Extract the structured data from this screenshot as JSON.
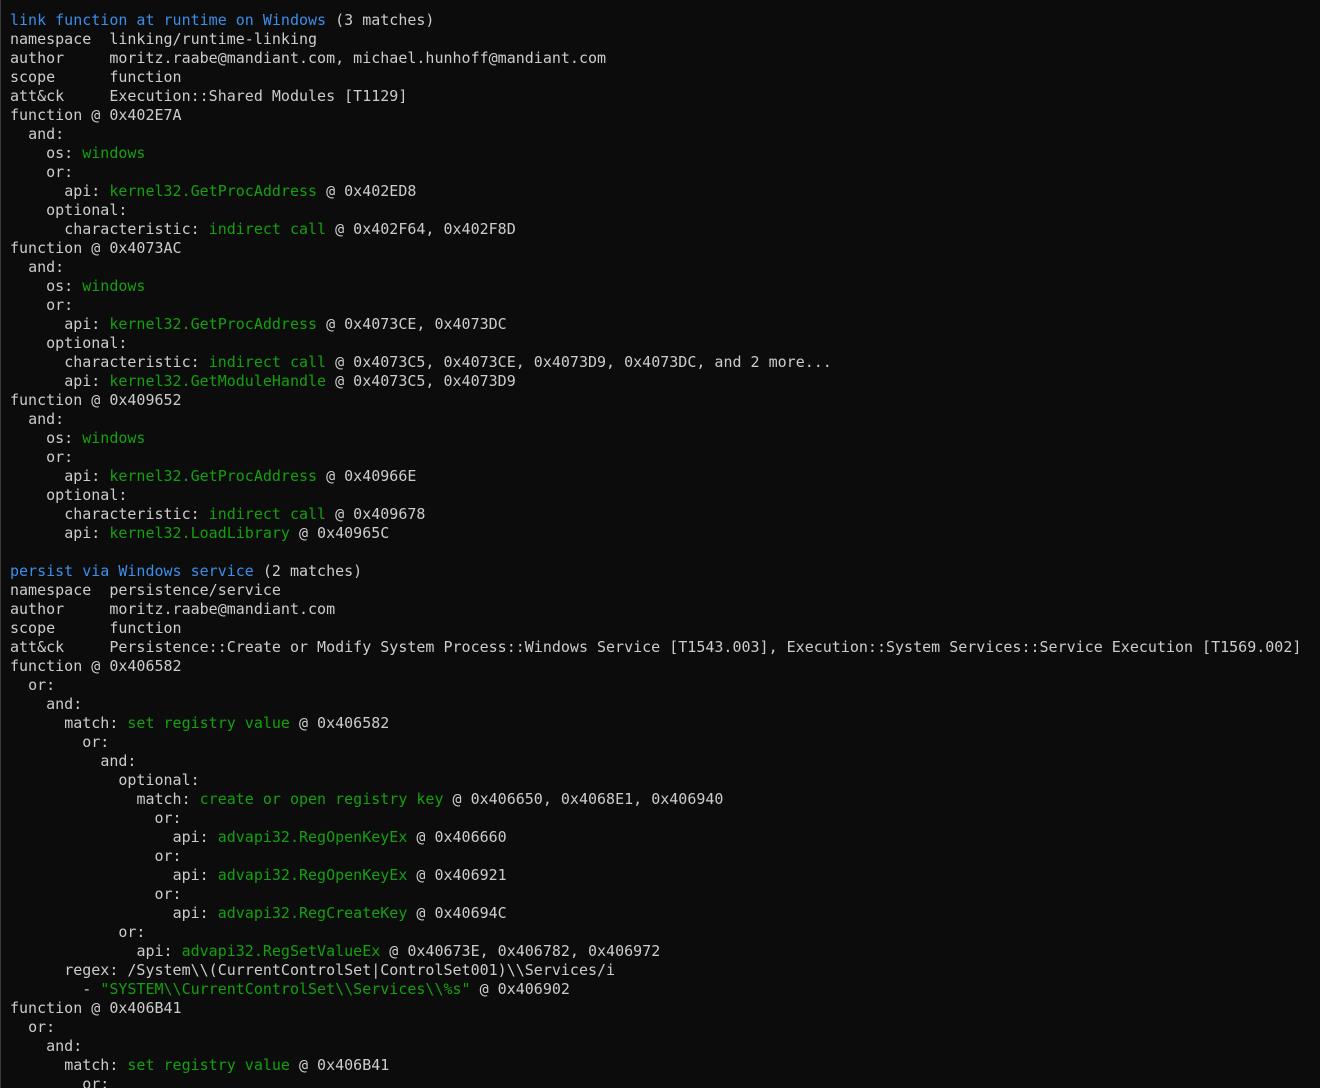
{
  "colors": {
    "background": "#0c0c0c",
    "text": "#cccccc",
    "rule_name": "#3b8eea",
    "feature_value": "#13a10e"
  },
  "lines": [
    {
      "indent": 0,
      "segments": [
        {
          "t": "link function at runtime on Windows",
          "c": "blue"
        },
        {
          "t": " (3 matches)",
          "c": "plain"
        }
      ]
    },
    {
      "indent": 0,
      "segments": [
        {
          "t": "namespace  linking/runtime-linking",
          "c": "plain"
        }
      ]
    },
    {
      "indent": 0,
      "segments": [
        {
          "t": "author     moritz.raabe@mandiant.com, michael.hunhoff@mandiant.com",
          "c": "plain"
        }
      ]
    },
    {
      "indent": 0,
      "segments": [
        {
          "t": "scope      function",
          "c": "plain"
        }
      ]
    },
    {
      "indent": 0,
      "segments": [
        {
          "t": "att&ck     Execution::Shared Modules [T1129]",
          "c": "plain"
        }
      ]
    },
    {
      "indent": 0,
      "segments": [
        {
          "t": "function @ 0x402E7A",
          "c": "plain"
        }
      ]
    },
    {
      "indent": 2,
      "segments": [
        {
          "t": "and:",
          "c": "plain"
        }
      ]
    },
    {
      "indent": 4,
      "segments": [
        {
          "t": "os: ",
          "c": "plain"
        },
        {
          "t": "windows",
          "c": "green"
        }
      ]
    },
    {
      "indent": 4,
      "segments": [
        {
          "t": "or:",
          "c": "plain"
        }
      ]
    },
    {
      "indent": 6,
      "segments": [
        {
          "t": "api: ",
          "c": "plain"
        },
        {
          "t": "kernel32.GetProcAddress",
          "c": "green"
        },
        {
          "t": " @ 0x402ED8",
          "c": "plain"
        }
      ]
    },
    {
      "indent": 4,
      "segments": [
        {
          "t": "optional:",
          "c": "plain"
        }
      ]
    },
    {
      "indent": 6,
      "segments": [
        {
          "t": "characteristic: ",
          "c": "plain"
        },
        {
          "t": "indirect call",
          "c": "green"
        },
        {
          "t": " @ 0x402F64, 0x402F8D",
          "c": "plain"
        }
      ]
    },
    {
      "indent": 0,
      "segments": [
        {
          "t": "function @ 0x4073AC",
          "c": "plain"
        }
      ]
    },
    {
      "indent": 2,
      "segments": [
        {
          "t": "and:",
          "c": "plain"
        }
      ]
    },
    {
      "indent": 4,
      "segments": [
        {
          "t": "os: ",
          "c": "plain"
        },
        {
          "t": "windows",
          "c": "green"
        }
      ]
    },
    {
      "indent": 4,
      "segments": [
        {
          "t": "or:",
          "c": "plain"
        }
      ]
    },
    {
      "indent": 6,
      "segments": [
        {
          "t": "api: ",
          "c": "plain"
        },
        {
          "t": "kernel32.GetProcAddress",
          "c": "green"
        },
        {
          "t": " @ 0x4073CE, 0x4073DC",
          "c": "plain"
        }
      ]
    },
    {
      "indent": 4,
      "segments": [
        {
          "t": "optional:",
          "c": "plain"
        }
      ]
    },
    {
      "indent": 6,
      "segments": [
        {
          "t": "characteristic: ",
          "c": "plain"
        },
        {
          "t": "indirect call",
          "c": "green"
        },
        {
          "t": " @ 0x4073C5, 0x4073CE, 0x4073D9, 0x4073DC, and 2 more...",
          "c": "plain"
        }
      ]
    },
    {
      "indent": 6,
      "segments": [
        {
          "t": "api: ",
          "c": "plain"
        },
        {
          "t": "kernel32.GetModuleHandle",
          "c": "green"
        },
        {
          "t": " @ 0x4073C5, 0x4073D9",
          "c": "plain"
        }
      ]
    },
    {
      "indent": 0,
      "segments": [
        {
          "t": "function @ 0x409652",
          "c": "plain"
        }
      ]
    },
    {
      "indent": 2,
      "segments": [
        {
          "t": "and:",
          "c": "plain"
        }
      ]
    },
    {
      "indent": 4,
      "segments": [
        {
          "t": "os: ",
          "c": "plain"
        },
        {
          "t": "windows",
          "c": "green"
        }
      ]
    },
    {
      "indent": 4,
      "segments": [
        {
          "t": "or:",
          "c": "plain"
        }
      ]
    },
    {
      "indent": 6,
      "segments": [
        {
          "t": "api: ",
          "c": "plain"
        },
        {
          "t": "kernel32.GetProcAddress",
          "c": "green"
        },
        {
          "t": " @ 0x40966E",
          "c": "plain"
        }
      ]
    },
    {
      "indent": 4,
      "segments": [
        {
          "t": "optional:",
          "c": "plain"
        }
      ]
    },
    {
      "indent": 6,
      "segments": [
        {
          "t": "characteristic: ",
          "c": "plain"
        },
        {
          "t": "indirect call",
          "c": "green"
        },
        {
          "t": " @ 0x409678",
          "c": "plain"
        }
      ]
    },
    {
      "indent": 6,
      "segments": [
        {
          "t": "api: ",
          "c": "plain"
        },
        {
          "t": "kernel32.LoadLibrary",
          "c": "green"
        },
        {
          "t": " @ 0x40965C",
          "c": "plain"
        }
      ]
    },
    {
      "indent": 0,
      "segments": []
    },
    {
      "indent": 0,
      "segments": [
        {
          "t": "persist via Windows service",
          "c": "blue"
        },
        {
          "t": " (2 matches)",
          "c": "plain"
        }
      ]
    },
    {
      "indent": 0,
      "segments": [
        {
          "t": "namespace  persistence/service",
          "c": "plain"
        }
      ]
    },
    {
      "indent": 0,
      "segments": [
        {
          "t": "author     moritz.raabe@mandiant.com",
          "c": "plain"
        }
      ]
    },
    {
      "indent": 0,
      "segments": [
        {
          "t": "scope      function",
          "c": "plain"
        }
      ]
    },
    {
      "indent": 0,
      "segments": [
        {
          "t": "att&ck     Persistence::Create or Modify System Process::Windows Service [T1543.003], Execution::System Services::Service Execution [T1569.002]",
          "c": "plain"
        }
      ]
    },
    {
      "indent": 0,
      "segments": [
        {
          "t": "function @ 0x406582",
          "c": "plain"
        }
      ]
    },
    {
      "indent": 2,
      "segments": [
        {
          "t": "or:",
          "c": "plain"
        }
      ]
    },
    {
      "indent": 4,
      "segments": [
        {
          "t": "and:",
          "c": "plain"
        }
      ]
    },
    {
      "indent": 6,
      "segments": [
        {
          "t": "match: ",
          "c": "plain"
        },
        {
          "t": "set registry value",
          "c": "green"
        },
        {
          "t": " @ 0x406582",
          "c": "plain"
        }
      ]
    },
    {
      "indent": 8,
      "segments": [
        {
          "t": "or:",
          "c": "plain"
        }
      ]
    },
    {
      "indent": 10,
      "segments": [
        {
          "t": "and:",
          "c": "plain"
        }
      ]
    },
    {
      "indent": 12,
      "segments": [
        {
          "t": "optional:",
          "c": "plain"
        }
      ]
    },
    {
      "indent": 14,
      "segments": [
        {
          "t": "match: ",
          "c": "plain"
        },
        {
          "t": "create or open registry key",
          "c": "green"
        },
        {
          "t": " @ 0x406650, 0x4068E1, 0x406940",
          "c": "plain"
        }
      ]
    },
    {
      "indent": 16,
      "segments": [
        {
          "t": "or:",
          "c": "plain"
        }
      ]
    },
    {
      "indent": 18,
      "segments": [
        {
          "t": "api: ",
          "c": "plain"
        },
        {
          "t": "advapi32.RegOpenKeyEx",
          "c": "green"
        },
        {
          "t": " @ 0x406660",
          "c": "plain"
        }
      ]
    },
    {
      "indent": 16,
      "segments": [
        {
          "t": "or:",
          "c": "plain"
        }
      ]
    },
    {
      "indent": 18,
      "segments": [
        {
          "t": "api: ",
          "c": "plain"
        },
        {
          "t": "advapi32.RegOpenKeyEx",
          "c": "green"
        },
        {
          "t": " @ 0x406921",
          "c": "plain"
        }
      ]
    },
    {
      "indent": 16,
      "segments": [
        {
          "t": "or:",
          "c": "plain"
        }
      ]
    },
    {
      "indent": 18,
      "segments": [
        {
          "t": "api: ",
          "c": "plain"
        },
        {
          "t": "advapi32.RegCreateKey",
          "c": "green"
        },
        {
          "t": " @ 0x40694C",
          "c": "plain"
        }
      ]
    },
    {
      "indent": 12,
      "segments": [
        {
          "t": "or:",
          "c": "plain"
        }
      ]
    },
    {
      "indent": 14,
      "segments": [
        {
          "t": "api: ",
          "c": "plain"
        },
        {
          "t": "advapi32.RegSetValueEx",
          "c": "green"
        },
        {
          "t": " @ 0x40673E, 0x406782, 0x406972",
          "c": "plain"
        }
      ]
    },
    {
      "indent": 6,
      "segments": [
        {
          "t": "regex: /System\\\\(CurrentControlSet|ControlSet001)\\\\Services/i",
          "c": "plain"
        }
      ]
    },
    {
      "indent": 8,
      "segments": [
        {
          "t": "- ",
          "c": "plain"
        },
        {
          "t": "\"SYSTEM\\\\CurrentControlSet\\\\Services\\\\%s\"",
          "c": "green"
        },
        {
          "t": " @ 0x406902",
          "c": "plain"
        }
      ]
    },
    {
      "indent": 0,
      "segments": [
        {
          "t": "function @ 0x406B41",
          "c": "plain"
        }
      ]
    },
    {
      "indent": 2,
      "segments": [
        {
          "t": "or:",
          "c": "plain"
        }
      ]
    },
    {
      "indent": 4,
      "segments": [
        {
          "t": "and:",
          "c": "plain"
        }
      ]
    },
    {
      "indent": 6,
      "segments": [
        {
          "t": "match: ",
          "c": "plain"
        },
        {
          "t": "set registry value",
          "c": "green"
        },
        {
          "t": " @ 0x406B41",
          "c": "plain"
        }
      ]
    },
    {
      "indent": 8,
      "segments": [
        {
          "t": "or:",
          "c": "plain"
        }
      ]
    }
  ]
}
